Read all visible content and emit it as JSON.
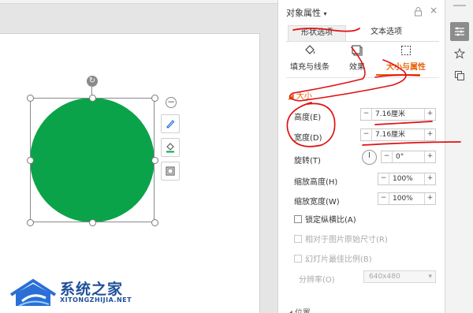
{
  "panel": {
    "title": "对象属性",
    "title_caret": "▾",
    "tabs": [
      {
        "label": "形状选项",
        "active": true
      },
      {
        "label": "文本选项",
        "active": false
      }
    ],
    "subtabs": [
      {
        "label": "填充与线条",
        "icon": "fill-bucket-icon"
      },
      {
        "label": "效果",
        "icon": "effects-icon"
      },
      {
        "label": "大小与属性",
        "icon": "size-frame-icon",
        "active": true
      }
    ],
    "section_title": "◢ 大小",
    "height_label": "高度(E)",
    "height_value": "7.16厘米",
    "width_label": "宽度(D)",
    "width_value": "7.16厘米",
    "rotation_label": "旋转(T)",
    "rotation_value": "0°",
    "scale_h_label": "缩放高度(H)",
    "scale_h_value": "100%",
    "scale_w_label": "缩放宽度(W)",
    "scale_w_value": "100%",
    "lock_ratio_label": "锁定纵横比(A)",
    "relative_label": "相对于图片原始尺寸(R)",
    "slide_best_label": "幻灯片最佳比例(B)",
    "dpi_label": "分辨率(O)",
    "dpi_value": "640x480",
    "next_section": "◢ 位置"
  },
  "spin": {
    "minus": "−",
    "plus": "+"
  },
  "float_tools": {
    "collapse": "−"
  },
  "watermark": {
    "title": "系统之家",
    "subtitle": "XITONGZHIJIA.NET"
  },
  "colors": {
    "shape_fill": "#0ba34a",
    "accent": "#e8650d",
    "annotation": "#e01010"
  }
}
